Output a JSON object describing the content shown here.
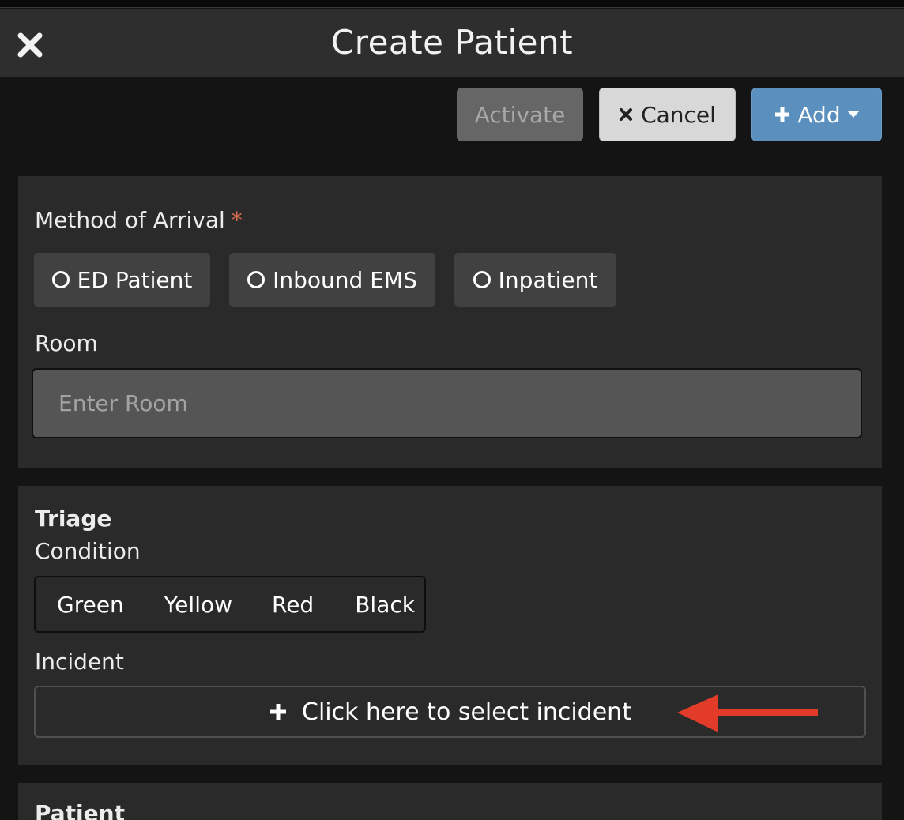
{
  "header": {
    "title": "Create Patient",
    "close_icon": "close-icon"
  },
  "toolbar": {
    "activate_label": "Activate",
    "cancel_label": "Cancel",
    "add_label": "Add"
  },
  "arrival": {
    "label": "Method of Arrival",
    "required_marker": "*",
    "options": [
      "ED Patient",
      "Inbound EMS",
      "Inpatient"
    ]
  },
  "room": {
    "label": "Room",
    "placeholder": "Enter Room",
    "value": ""
  },
  "triage": {
    "heading": "Triage",
    "condition_label": "Condition",
    "conditions": [
      "Green",
      "Yellow",
      "Red",
      "Black"
    ]
  },
  "incident": {
    "label": "Incident",
    "button_label": "Click here to select incident"
  },
  "patient": {
    "heading": "Patient"
  },
  "colors": {
    "accent_add": "#5a8fbe",
    "required": "#d96b4f",
    "annotation_arrow": "#e23b2a"
  }
}
